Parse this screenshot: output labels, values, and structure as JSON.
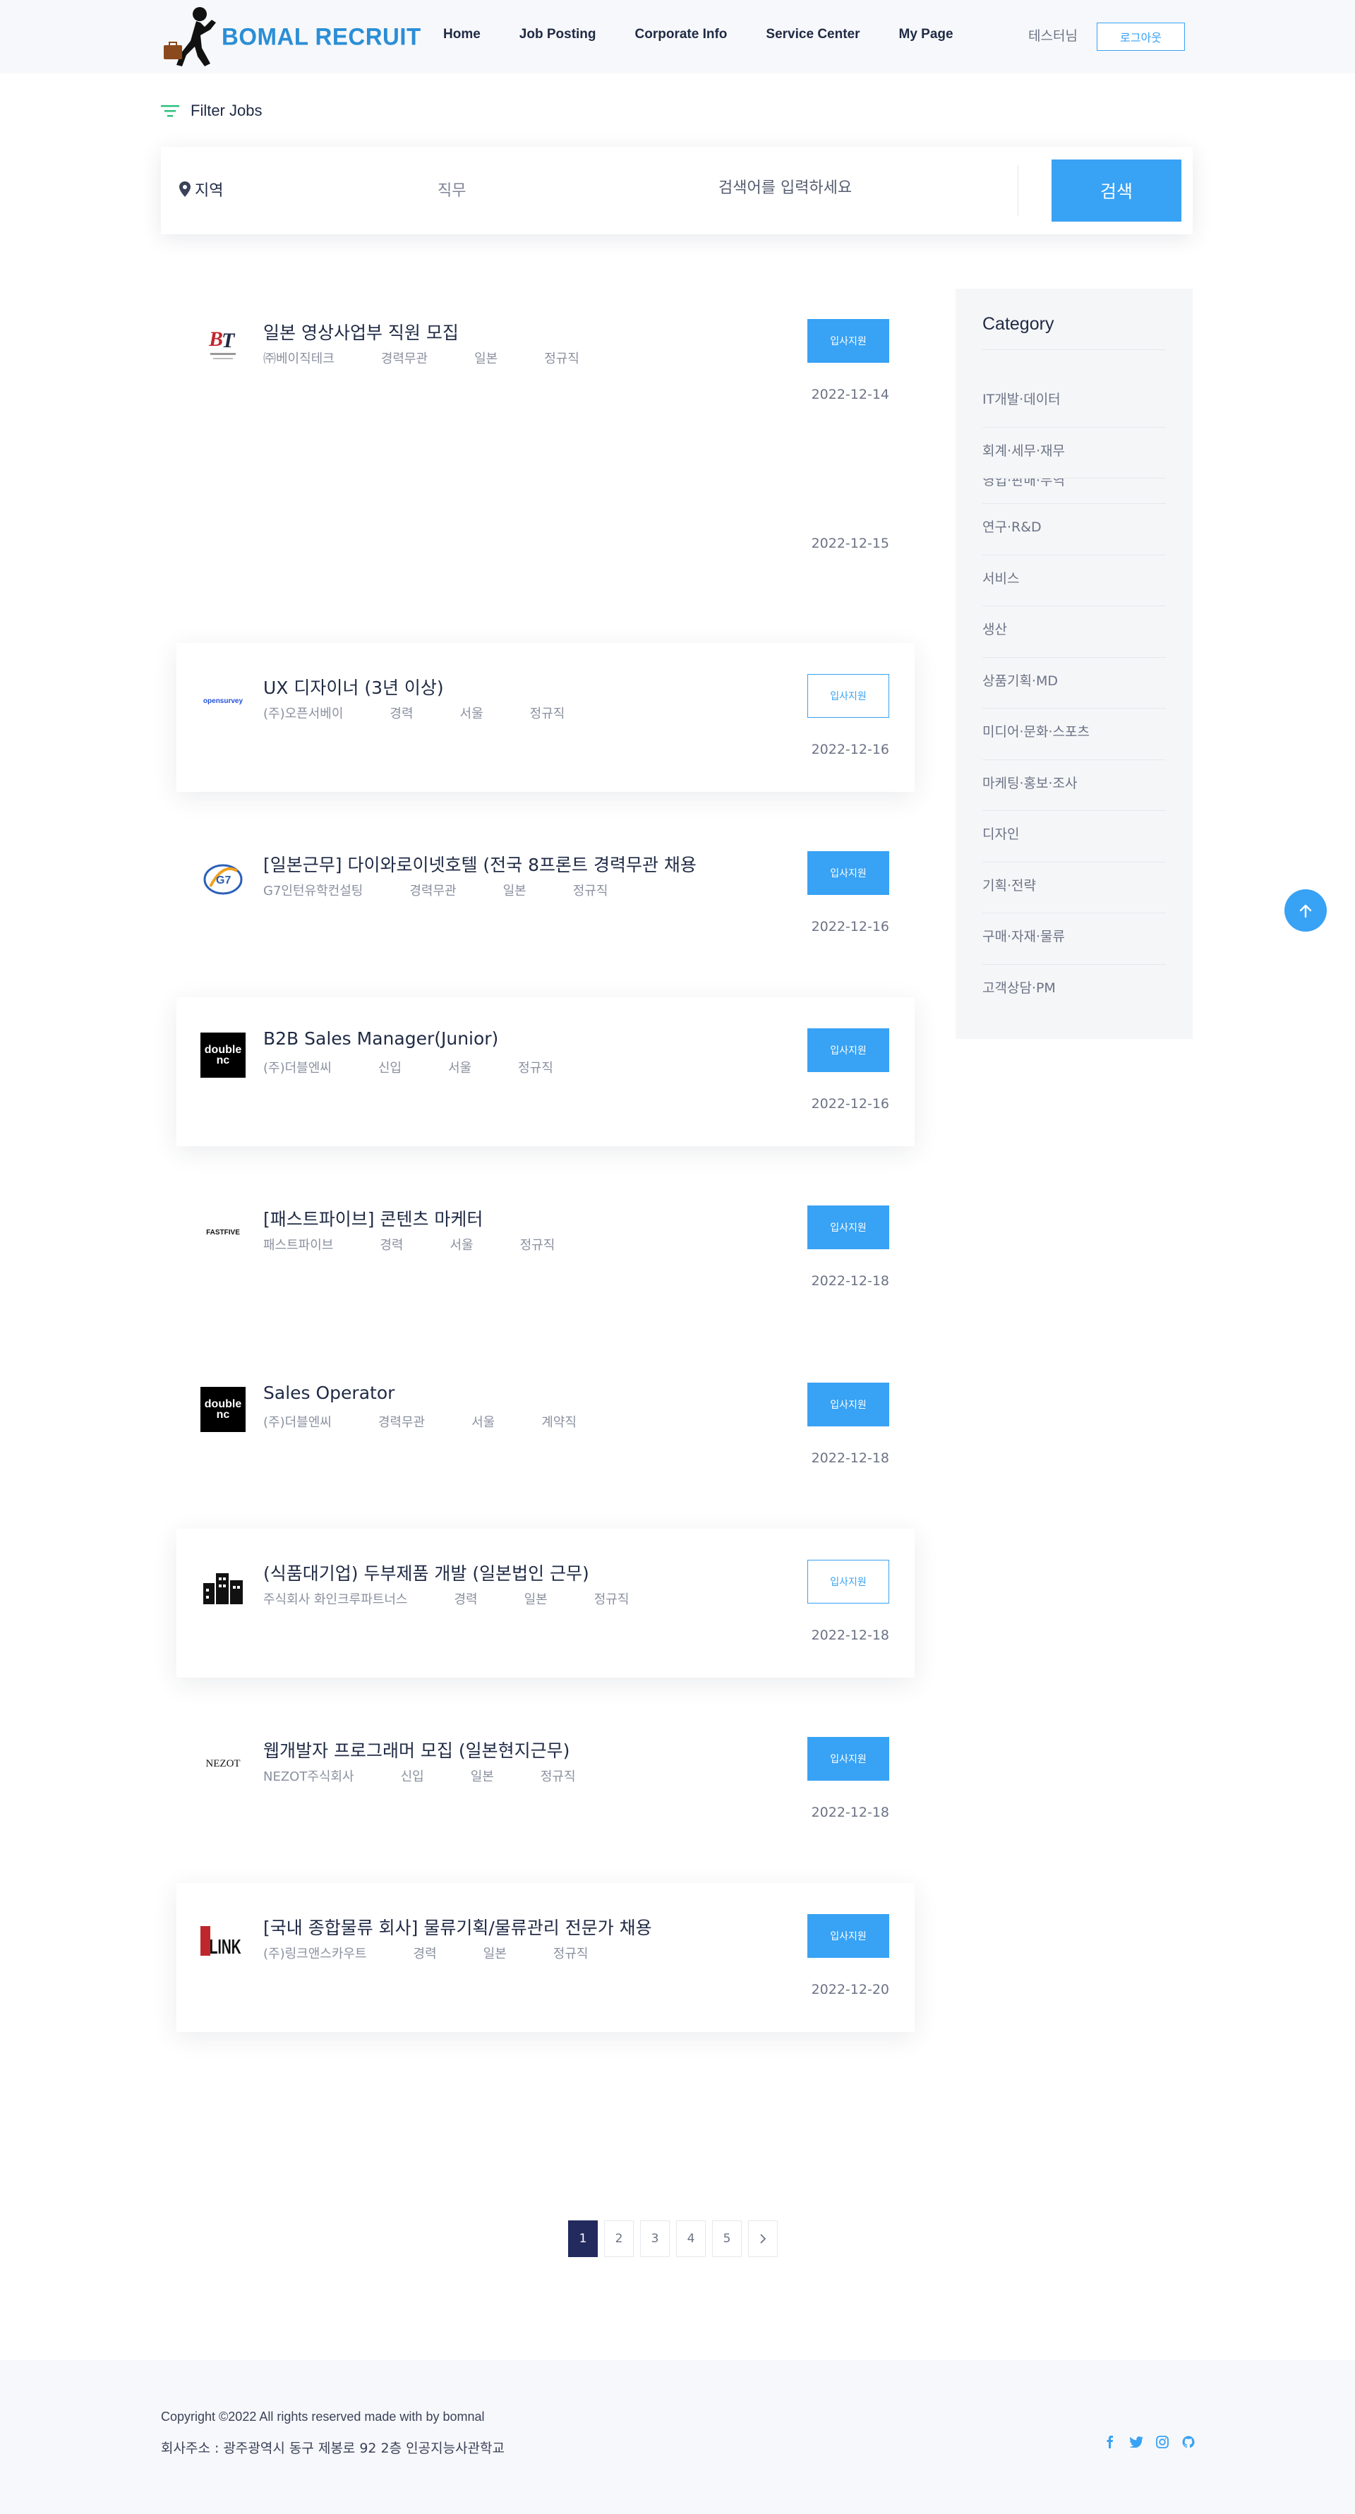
{
  "header": {
    "brand": "BOMAL RECRUIT",
    "nav": [
      "Home",
      "Job Posting",
      "Corporate Info",
      "Service Center",
      "My Page"
    ],
    "user_name": "테스터님",
    "logout_label": "로그아웃"
  },
  "filter": {
    "title": "Filter Jobs",
    "region_label": "지역",
    "job_label": "직무",
    "search_placeholder": "검색어를 입력하세요",
    "search_button": "검색"
  },
  "jobs": [
    {
      "title": "일본 영상사업부 직원 모집",
      "company": "㈜베이직테크",
      "career": "경력무관",
      "location": "일본",
      "type": "정규직",
      "apply": "입사지원",
      "date": "2022-12-14",
      "logo_text": "BT"
    },
    {
      "title": "",
      "company": "",
      "career": "",
      "location": "",
      "type": "",
      "apply": "",
      "date": "2022-12-15",
      "logo_text": ""
    },
    {
      "title": "UX 디자이너 (3년 이상)",
      "company": "(주)오픈서베이",
      "career": "경력",
      "location": "서울",
      "type": "정규직",
      "apply": "입사지원",
      "date": "2022-12-16",
      "logo_text": "opensurvey"
    },
    {
      "title": "[일본근무] 다이와로이넷호텔 (전국 8프론트 경력무관 채용",
      "company": "G7인턴유학컨설팅",
      "career": "경력무관",
      "location": "일본",
      "type": "정규직",
      "apply": "입사지원",
      "date": "2022-12-16",
      "logo_text": "G7"
    },
    {
      "title": "B2B Sales Manager(Junior)",
      "company": "(주)더블엔씨",
      "career": "신입",
      "location": "서울",
      "type": "정규직",
      "apply": "입사지원",
      "date": "2022-12-16",
      "logo_text": "double nc"
    },
    {
      "title": "[패스트파이브] 콘텐츠 마케터",
      "company": "패스트파이브",
      "career": "경력",
      "location": "서울",
      "type": "정규직",
      "apply": "입사지원",
      "date": "2022-12-18",
      "logo_text": "FASTFIVE"
    },
    {
      "title": "Sales Operator",
      "company": "(주)더블엔씨",
      "career": "경력무관",
      "location": "서울",
      "type": "계약직",
      "apply": "입사지원",
      "date": "2022-12-18",
      "logo_text": "double nc"
    },
    {
      "title": "(식품대기업) 두부제품 개발 (일본법인 근무)",
      "company": "주식회사 화인크루파트너스",
      "career": "경력",
      "location": "일본",
      "type": "정규직",
      "apply": "입사지원",
      "date": "2022-12-18",
      "logo_text": ""
    },
    {
      "title": "웹개발자 프로그래머 모집 (일본현지근무)",
      "company": "NEZOT주식회사",
      "career": "신입",
      "location": "일본",
      "type": "정규직",
      "apply": "입사지원",
      "date": "2022-12-18",
      "logo_text": "NEZOT"
    },
    {
      "title": "[국내 종합물류 회사] 물류기획/물류관리 전문가 채용",
      "company": "(주)링크앤스카우트",
      "career": "경력",
      "location": "일본",
      "type": "정규직",
      "apply": "입사지원",
      "date": "2022-12-20",
      "logo_text": "LINKSCOUT"
    }
  ],
  "sidebar": {
    "title": "Category",
    "items": [
      "IT개발·데이터",
      "회계·세무·재무",
      "영업·판매·무역",
      "연구·R&D",
      "서비스",
      "생산",
      "상품기획·MD",
      "미디어·문화·스포츠",
      "마케팅·홍보·조사",
      "디자인",
      "기획·전략",
      "구매·자재·물류",
      "고객상담·PM"
    ]
  },
  "pagination": [
    "1",
    "2",
    "3",
    "4",
    "5"
  ],
  "footer": {
    "copyright": "Copyright ©2022 All rights reserved made with by bomnal",
    "address": "회사주소 : 광주광역시 동구 제봉로 92 2층 인공지능사관학교"
  },
  "colors": {
    "accent": "#38a2f4",
    "dark_navy": "#232a5e",
    "text": "#1f2a44",
    "muted": "#8a909f"
  }
}
